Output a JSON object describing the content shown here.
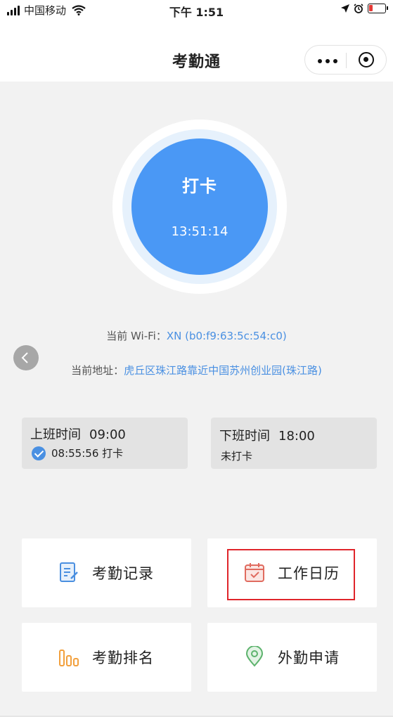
{
  "status_bar": {
    "carrier": "中国移动",
    "time": "下午 1:51"
  },
  "nav": {
    "title": "考勤通"
  },
  "punch": {
    "label": "打卡",
    "time": "13:51:14"
  },
  "wifi": {
    "label": "当前 Wi-Fi：",
    "value": "XN (b0:f9:63:5c:54:c0)"
  },
  "location": {
    "label": "当前地址：",
    "value": "虎丘区珠江路靠近中国苏州创业园(珠江路)"
  },
  "on_duty": {
    "title": "上班时间",
    "time": "09:00",
    "status": "08:55:56 打卡"
  },
  "off_duty": {
    "title": "下班时间",
    "time": "18:00",
    "status": "未打卡"
  },
  "menu": {
    "records": "考勤记录",
    "calendar": "工作日历",
    "ranking": "考勤排名",
    "field": "外勤申请"
  },
  "colors": {
    "accent": "#4a98f5",
    "link": "#4a90e2",
    "highlight": "#e0252b",
    "calendar_icon": "#e06b5f",
    "ranking_icon": "#f2a03d",
    "field_icon": "#5db36d"
  },
  "icons": [
    "signal-icon",
    "wifi-icon",
    "location-arrow-icon",
    "alarm-icon",
    "battery-icon",
    "more-icon",
    "target-icon",
    "chevron-left-icon",
    "check-icon",
    "document-icon",
    "calendar-icon",
    "bar-chart-icon",
    "map-pin-icon"
  ]
}
